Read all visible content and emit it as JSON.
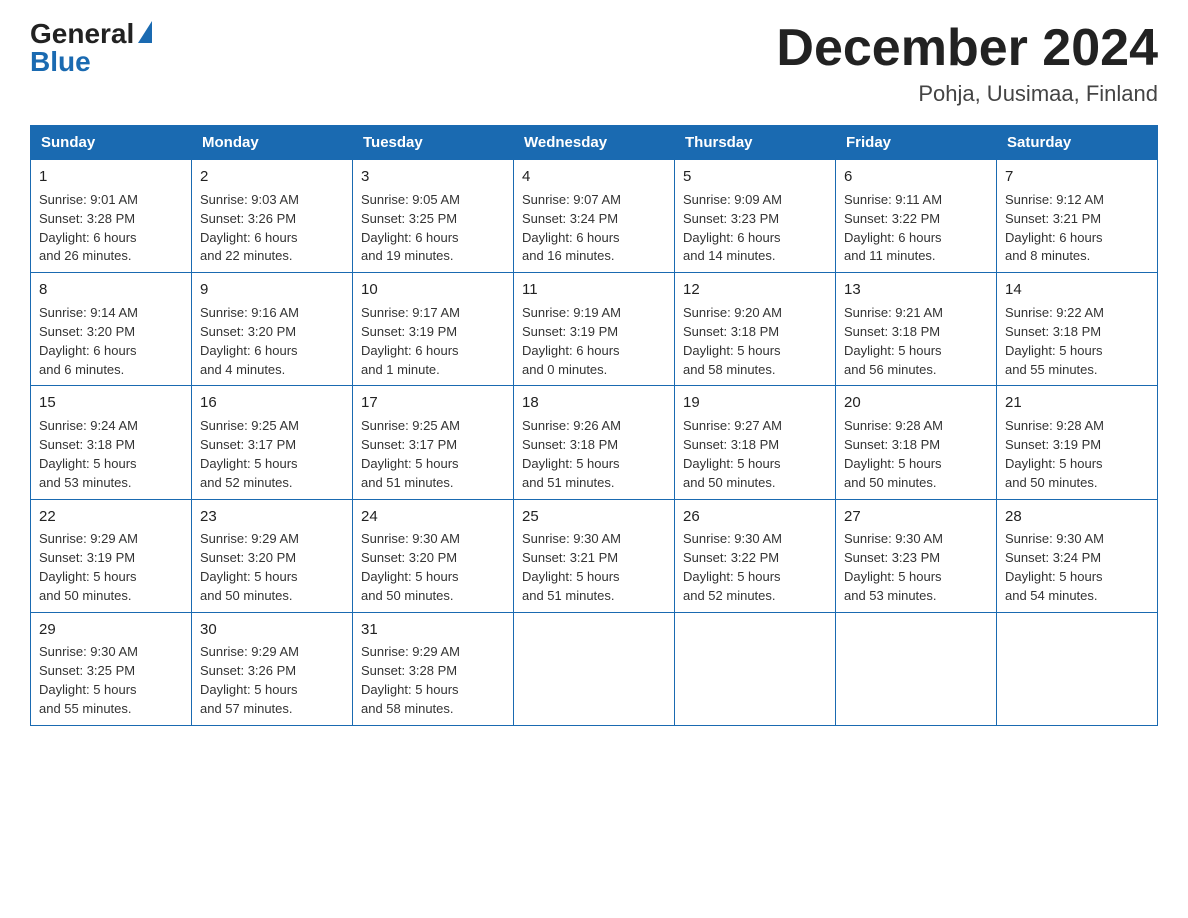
{
  "logo": {
    "general": "General",
    "blue": "Blue"
  },
  "title": "December 2024",
  "subtitle": "Pohja, Uusimaa, Finland",
  "weekdays": [
    "Sunday",
    "Monday",
    "Tuesday",
    "Wednesday",
    "Thursday",
    "Friday",
    "Saturday"
  ],
  "weeks": [
    [
      {
        "day": "1",
        "info": "Sunrise: 9:01 AM\nSunset: 3:28 PM\nDaylight: 6 hours\nand 26 minutes."
      },
      {
        "day": "2",
        "info": "Sunrise: 9:03 AM\nSunset: 3:26 PM\nDaylight: 6 hours\nand 22 minutes."
      },
      {
        "day": "3",
        "info": "Sunrise: 9:05 AM\nSunset: 3:25 PM\nDaylight: 6 hours\nand 19 minutes."
      },
      {
        "day": "4",
        "info": "Sunrise: 9:07 AM\nSunset: 3:24 PM\nDaylight: 6 hours\nand 16 minutes."
      },
      {
        "day": "5",
        "info": "Sunrise: 9:09 AM\nSunset: 3:23 PM\nDaylight: 6 hours\nand 14 minutes."
      },
      {
        "day": "6",
        "info": "Sunrise: 9:11 AM\nSunset: 3:22 PM\nDaylight: 6 hours\nand 11 minutes."
      },
      {
        "day": "7",
        "info": "Sunrise: 9:12 AM\nSunset: 3:21 PM\nDaylight: 6 hours\nand 8 minutes."
      }
    ],
    [
      {
        "day": "8",
        "info": "Sunrise: 9:14 AM\nSunset: 3:20 PM\nDaylight: 6 hours\nand 6 minutes."
      },
      {
        "day": "9",
        "info": "Sunrise: 9:16 AM\nSunset: 3:20 PM\nDaylight: 6 hours\nand 4 minutes."
      },
      {
        "day": "10",
        "info": "Sunrise: 9:17 AM\nSunset: 3:19 PM\nDaylight: 6 hours\nand 1 minute."
      },
      {
        "day": "11",
        "info": "Sunrise: 9:19 AM\nSunset: 3:19 PM\nDaylight: 6 hours\nand 0 minutes."
      },
      {
        "day": "12",
        "info": "Sunrise: 9:20 AM\nSunset: 3:18 PM\nDaylight: 5 hours\nand 58 minutes."
      },
      {
        "day": "13",
        "info": "Sunrise: 9:21 AM\nSunset: 3:18 PM\nDaylight: 5 hours\nand 56 minutes."
      },
      {
        "day": "14",
        "info": "Sunrise: 9:22 AM\nSunset: 3:18 PM\nDaylight: 5 hours\nand 55 minutes."
      }
    ],
    [
      {
        "day": "15",
        "info": "Sunrise: 9:24 AM\nSunset: 3:18 PM\nDaylight: 5 hours\nand 53 minutes."
      },
      {
        "day": "16",
        "info": "Sunrise: 9:25 AM\nSunset: 3:17 PM\nDaylight: 5 hours\nand 52 minutes."
      },
      {
        "day": "17",
        "info": "Sunrise: 9:25 AM\nSunset: 3:17 PM\nDaylight: 5 hours\nand 51 minutes."
      },
      {
        "day": "18",
        "info": "Sunrise: 9:26 AM\nSunset: 3:18 PM\nDaylight: 5 hours\nand 51 minutes."
      },
      {
        "day": "19",
        "info": "Sunrise: 9:27 AM\nSunset: 3:18 PM\nDaylight: 5 hours\nand 50 minutes."
      },
      {
        "day": "20",
        "info": "Sunrise: 9:28 AM\nSunset: 3:18 PM\nDaylight: 5 hours\nand 50 minutes."
      },
      {
        "day": "21",
        "info": "Sunrise: 9:28 AM\nSunset: 3:19 PM\nDaylight: 5 hours\nand 50 minutes."
      }
    ],
    [
      {
        "day": "22",
        "info": "Sunrise: 9:29 AM\nSunset: 3:19 PM\nDaylight: 5 hours\nand 50 minutes."
      },
      {
        "day": "23",
        "info": "Sunrise: 9:29 AM\nSunset: 3:20 PM\nDaylight: 5 hours\nand 50 minutes."
      },
      {
        "day": "24",
        "info": "Sunrise: 9:30 AM\nSunset: 3:20 PM\nDaylight: 5 hours\nand 50 minutes."
      },
      {
        "day": "25",
        "info": "Sunrise: 9:30 AM\nSunset: 3:21 PM\nDaylight: 5 hours\nand 51 minutes."
      },
      {
        "day": "26",
        "info": "Sunrise: 9:30 AM\nSunset: 3:22 PM\nDaylight: 5 hours\nand 52 minutes."
      },
      {
        "day": "27",
        "info": "Sunrise: 9:30 AM\nSunset: 3:23 PM\nDaylight: 5 hours\nand 53 minutes."
      },
      {
        "day": "28",
        "info": "Sunrise: 9:30 AM\nSunset: 3:24 PM\nDaylight: 5 hours\nand 54 minutes."
      }
    ],
    [
      {
        "day": "29",
        "info": "Sunrise: 9:30 AM\nSunset: 3:25 PM\nDaylight: 5 hours\nand 55 minutes."
      },
      {
        "day": "30",
        "info": "Sunrise: 9:29 AM\nSunset: 3:26 PM\nDaylight: 5 hours\nand 57 minutes."
      },
      {
        "day": "31",
        "info": "Sunrise: 9:29 AM\nSunset: 3:28 PM\nDaylight: 5 hours\nand 58 minutes."
      },
      null,
      null,
      null,
      null
    ]
  ]
}
